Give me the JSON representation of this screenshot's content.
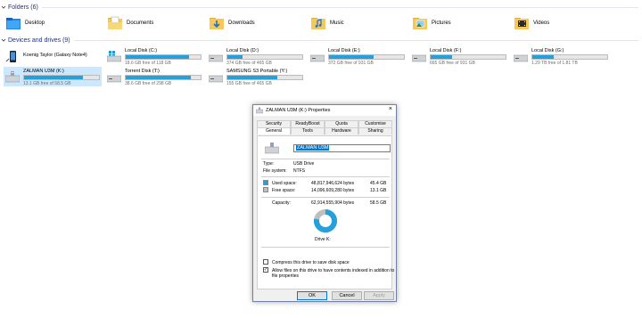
{
  "folders_section": {
    "title": "Folders (6)"
  },
  "folders": [
    {
      "name": "Desktop",
      "icon": "desktop-folder-icon"
    },
    {
      "name": "Documents",
      "icon": "documents-folder-icon"
    },
    {
      "name": "Downloads",
      "icon": "downloads-folder-icon"
    },
    {
      "name": "Music",
      "icon": "music-folder-icon"
    },
    {
      "name": "Pictures",
      "icon": "pictures-folder-icon"
    },
    {
      "name": "Videos",
      "icon": "videos-folder-icon"
    }
  ],
  "devices_section": {
    "title": "Devices and drives (9)"
  },
  "drives": [
    {
      "name": "Koenig Taylor (Galaxy Note4)",
      "kind": "phone"
    },
    {
      "name": "Local Disk (C:)",
      "free": "18.6 GB free of 118 GB",
      "used_fraction": 0.84,
      "kind": "windows-disk"
    },
    {
      "name": "Local Disk (D:)",
      "free": "374 GB free of 465 GB",
      "used_fraction": 0.2,
      "kind": "disk"
    },
    {
      "name": "Local Disk (E:)",
      "free": "372 GB free of 931 GB",
      "used_fraction": 0.6,
      "kind": "disk"
    },
    {
      "name": "Local Disk (F:)",
      "free": "665 GB free of 931 GB",
      "used_fraction": 0.29,
      "kind": "disk"
    },
    {
      "name": "Local Disk (G:)",
      "free": "1.29 TB free of 1.81 TB",
      "used_fraction": 0.29,
      "kind": "disk"
    },
    {
      "name": "ZALMAN U3M (K:)",
      "free": "13.1 GB free of 58.5 GB",
      "used_fraction": 0.78,
      "kind": "usb",
      "selected": true
    },
    {
      "name": "Torrent Disk (T:)",
      "free": "38.6 GB free of 298 GB",
      "used_fraction": 0.87,
      "kind": "disk"
    },
    {
      "name": "SAMSUNG S3 Portable (Y:)",
      "free": "155 GB free of 465 GB",
      "used_fraction": 0.67,
      "kind": "disk"
    }
  ],
  "dialog": {
    "title": "ZALMAN U3M (K:) Properties",
    "close_glyph": "×",
    "tabs_row1": [
      "Security",
      "ReadyBoost",
      "Quota",
      "Customise"
    ],
    "tabs_row2": [
      "General",
      "Tools",
      "Hardware",
      "Sharing"
    ],
    "active_tab": "General",
    "drive_name_value": "ZALMAN U3M",
    "type_label": "Type:",
    "type_value": "USB Drive",
    "fs_label": "File system:",
    "fs_value": "NTFS",
    "used_label": "Used space:",
    "used_bytes": "48,817,946,624 bytes",
    "used_size": "45.4 GB",
    "free_label": "Free space:",
    "free_bytes": "14,096,609,280 bytes",
    "free_size": "13.1 GB",
    "capacity_label": "Capacity:",
    "capacity_bytes": "62,914,555,904 bytes",
    "capacity_size": "58.5 GB",
    "used_fraction": 0.776,
    "used_color": "#26a0da",
    "free_color": "#bfbfbf",
    "drive_caption": "Drive K:",
    "compress_label": "Compress this drive to save disk space",
    "compress_checked": false,
    "index_label_line1": "Allow files on this drive to have contents indexed in addition to",
    "index_label_line2": "file properties",
    "index_checked": true,
    "ok_label": "OK",
    "cancel_label": "Cancel",
    "apply_label": "Apply"
  },
  "colors": {
    "section_title": "#1e3287",
    "progress": "#26a0da",
    "selection": "#cce8ff",
    "accent": "#0078d7"
  }
}
